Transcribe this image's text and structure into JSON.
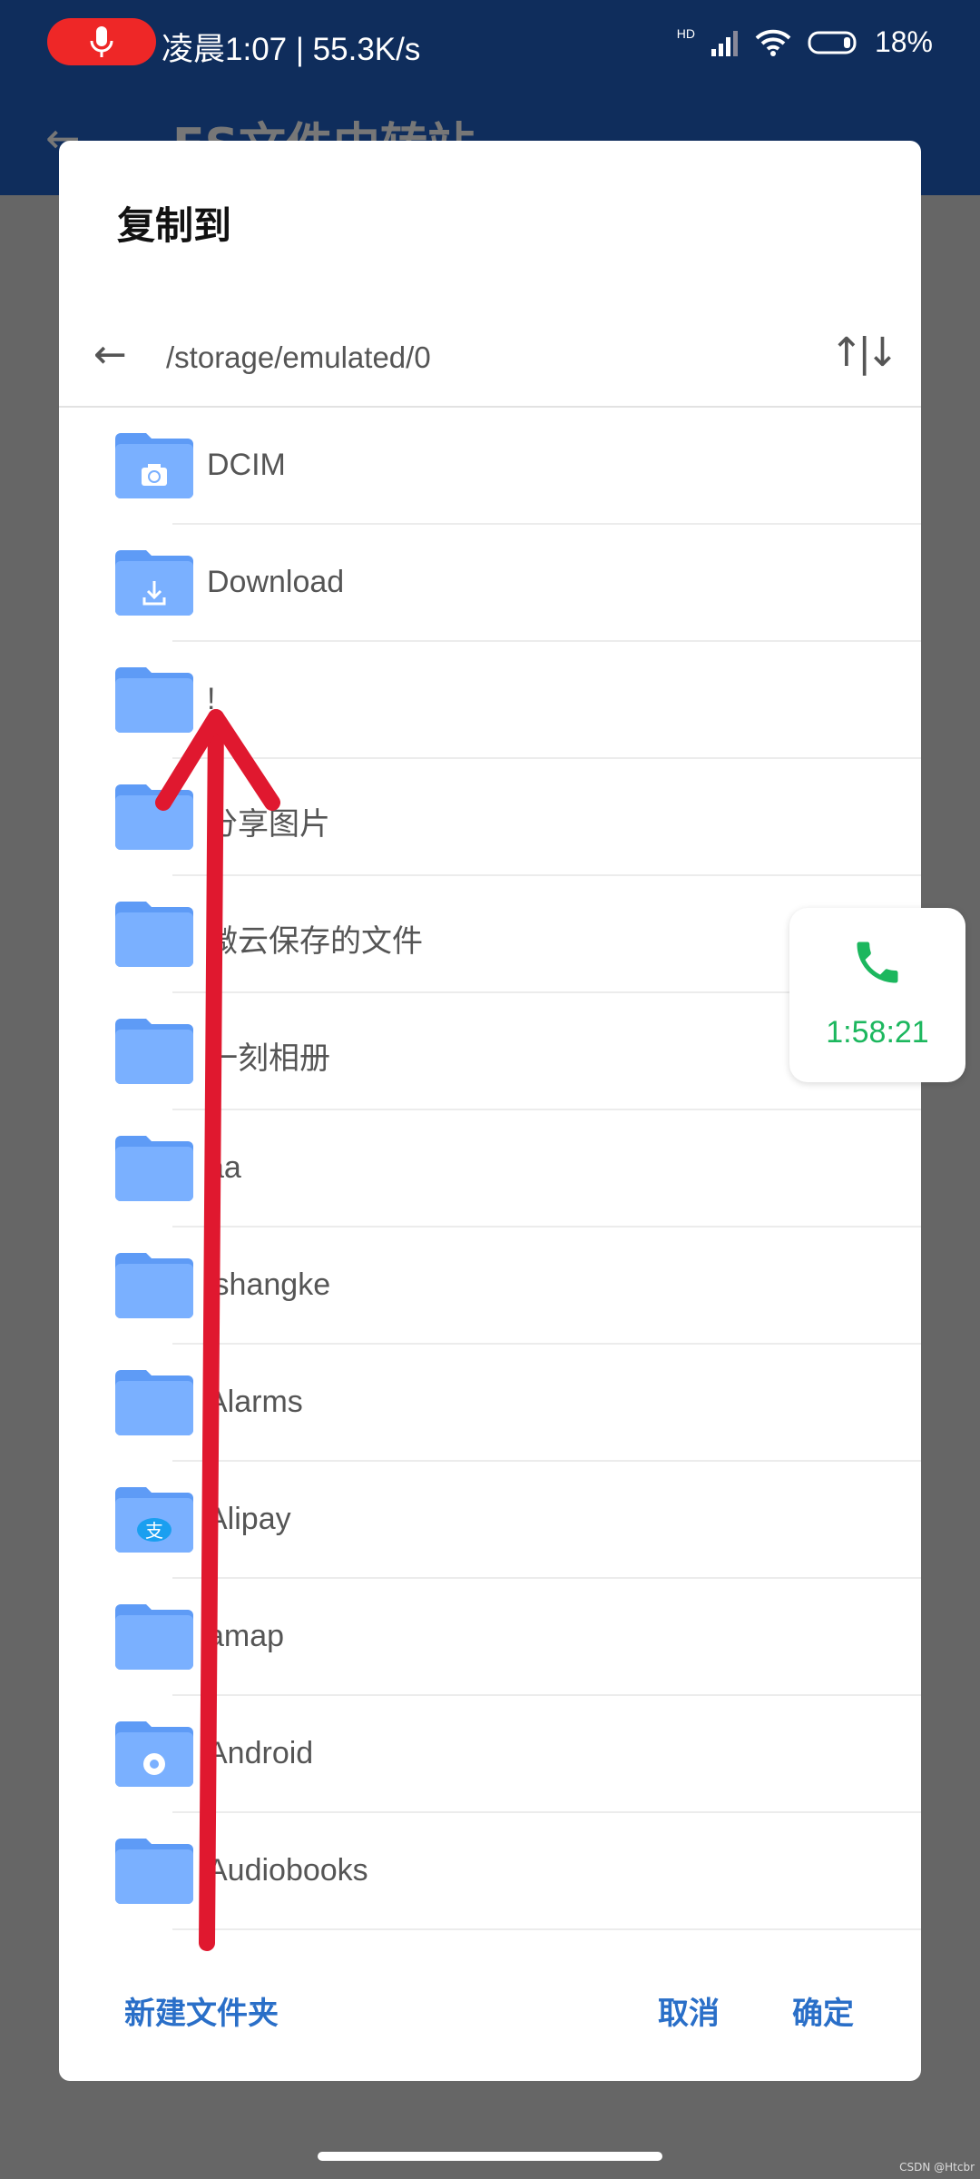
{
  "status_bar": {
    "time": "凌晨1:07 | 55.3K/s",
    "network": "HD",
    "battery": "18%"
  },
  "app": {
    "title": "ES文件中转站"
  },
  "dialog": {
    "title": "复制到",
    "path": "/storage/emulated/0",
    "folders": [
      {
        "name": "DCIM",
        "icon": "camera"
      },
      {
        "name": "Download",
        "icon": "download"
      },
      {
        "name": "!",
        "icon": "folder"
      },
      {
        "name": "分享图片",
        "icon": "folder"
      },
      {
        "name": "微云保存的文件",
        "icon": "folder"
      },
      {
        "name": "一刻相册",
        "icon": "folder"
      },
      {
        "name": "aa",
        "icon": "folder"
      },
      {
        "name": "ishangke",
        "icon": "folder"
      },
      {
        "name": "Alarms",
        "icon": "folder"
      },
      {
        "name": "Alipay",
        "icon": "alipay"
      },
      {
        "name": "amap",
        "icon": "folder"
      },
      {
        "name": "Android",
        "icon": "gear"
      },
      {
        "name": "Audiobooks",
        "icon": "folder"
      }
    ],
    "new_folder": "新建文件夹",
    "cancel": "取消",
    "confirm": "确定"
  },
  "call_widget": {
    "duration": "1:58:21"
  },
  "watermark": "CSDN @Htcbr",
  "colors": {
    "header": "#0f2d5c",
    "folder": "#7ab0ff",
    "accent": "#2a6fc8",
    "annotation_arrow": "#e0182f"
  }
}
